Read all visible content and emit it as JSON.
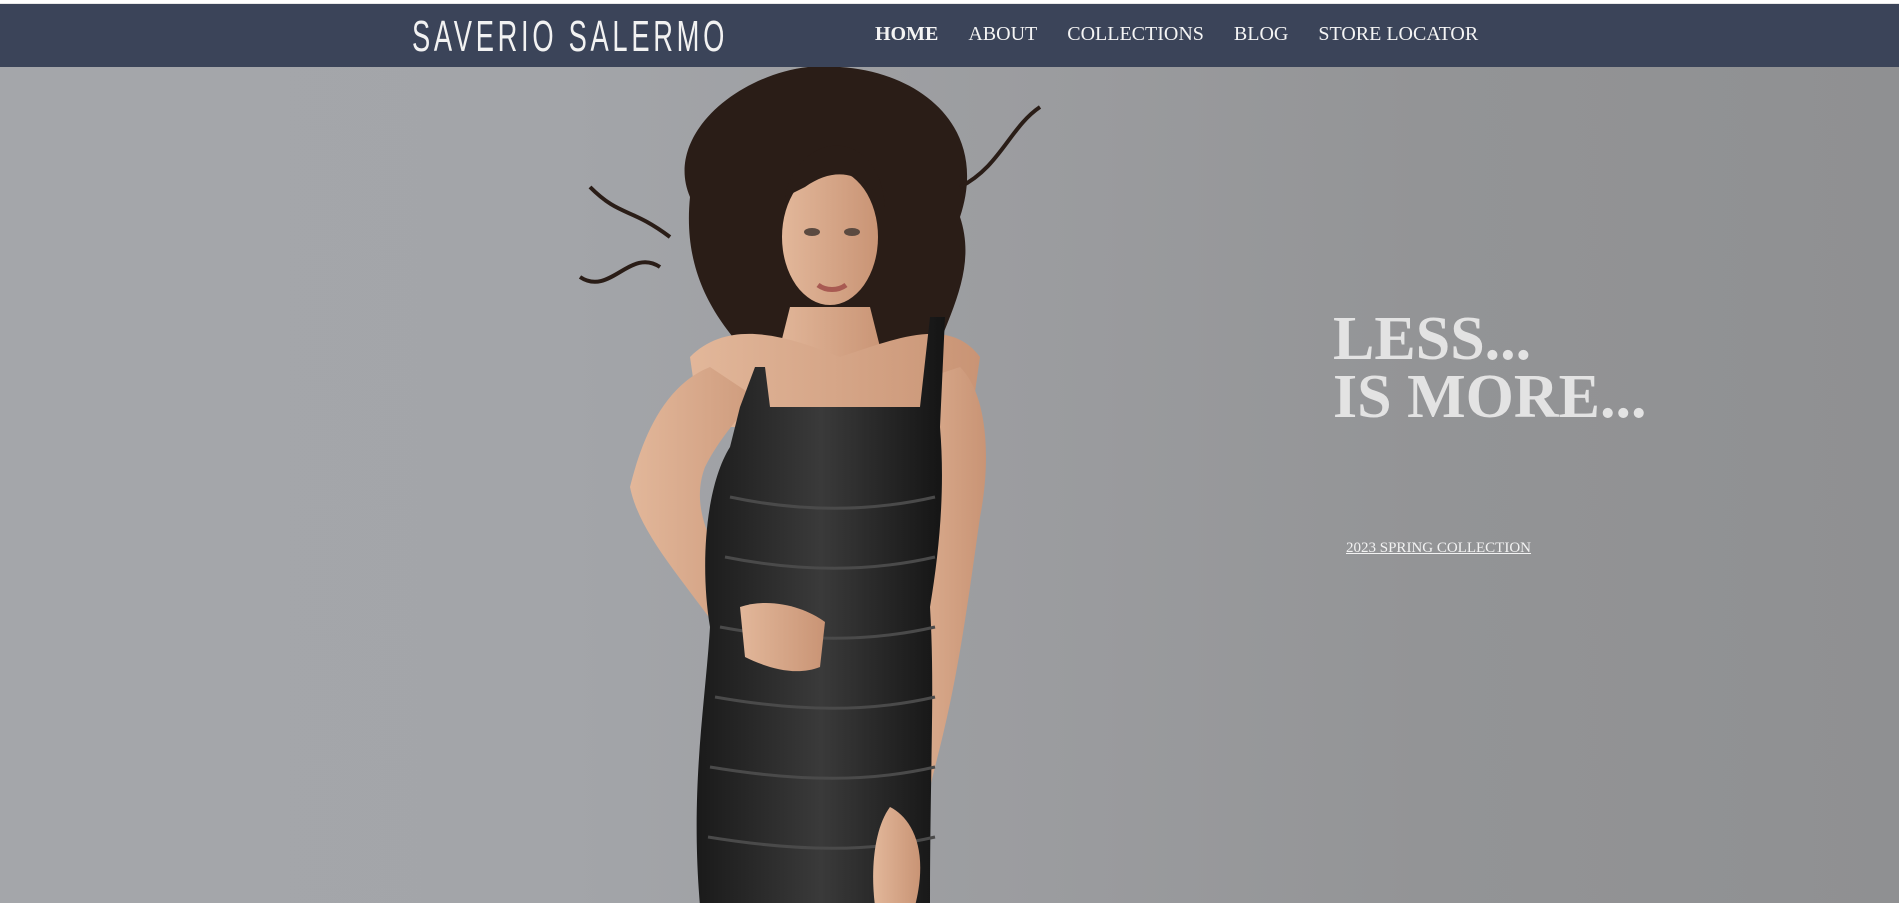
{
  "header": {
    "logo_text": "SAVERIO SALERMO",
    "nav": [
      {
        "label": "HOME",
        "active": true
      },
      {
        "label": "ABOUT",
        "active": false
      },
      {
        "label": "COLLECTIONS",
        "active": false
      },
      {
        "label": "BLOG",
        "active": false
      },
      {
        "label": "STORE LOCATOR",
        "active": false
      }
    ]
  },
  "hero": {
    "headline_line1": "LESS...",
    "headline_line2": "IS MORE...",
    "cta_label": "2023 SPRING COLLECTION",
    "image_subject": "model-in-black-satin-dress"
  },
  "colors": {
    "navbar": "#3b4459",
    "hero_background": "#9b9c9f",
    "headline": "#e3e3e3"
  }
}
